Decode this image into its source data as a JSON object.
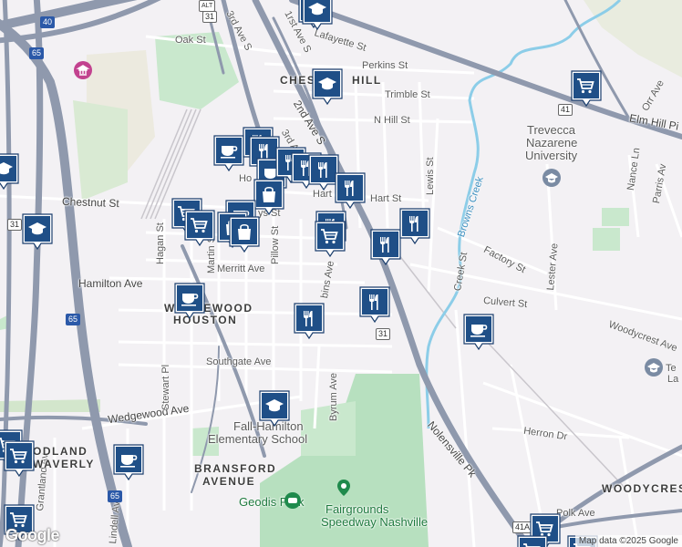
{
  "map": {
    "streets": {
      "oak": "Oak St",
      "lafayette": "Lafayette St",
      "perkins": "Perkins St",
      "trimble": "Trimble St",
      "n_hill": "N Hill St",
      "chestnut": "Chestnut St",
      "hart": "Hart St",
      "hart_short": "Hart",
      "ys": "ys St",
      "merritt": "Merritt Ave",
      "hamilton": "Hamilton Ave",
      "southgate": "Southgate Ave",
      "wedgewood": "Wedgewood Ave",
      "byrum": "Byrum Ave",
      "stewart": "Stewart Pl",
      "pillow": "Pillow St",
      "martin": "Martin St",
      "hagan": "Hagan St",
      "second_ave": "2nd Ave S",
      "third_ave": "3rd Ave",
      "first_ave": "1rst Ave S",
      "third_ave_s": "3rd Ave S",
      "lewis": "Lewis St",
      "factory": "Factory St",
      "culvert": "Culvert St",
      "creek": "Creek St",
      "lester": "Lester Ave",
      "woodycrest_ave": "Woodycrest Ave",
      "herron": "Herron Dr",
      "nolensville": "Nolensville Pk",
      "elm_hill": "Elm Hill Pi",
      "nance": "Nance Ln",
      "parris": "Parris Av",
      "orr": "Orr Ave",
      "browns_creek": "Browns Creek",
      "grantland": "Grantland Av",
      "lindell": "Lindell Av",
      "polk": "Polk Ave",
      "elkins": "bins Ave",
      "ho": "Ho",
      "fragment_br": "Te",
      "fragment_br2": "La"
    },
    "neighborhoods": {
      "chestnut_hill": "CHESTNUT HILL",
      "chestnut_hill_left": "CHES",
      "chestnut_hill_right": "HILL",
      "wedgewood_houston_1": "WEDGEWOOD",
      "wedgewood_houston_2": "HOUSTON",
      "bransford_1": "BRANSFORD",
      "bransford_2": "AVENUE",
      "woodland_1": "ODLAND",
      "woodland_2": "WAVERLY",
      "woodycrest": "WOODYCREST"
    },
    "places": {
      "trevecca_1": "Trevecca",
      "trevecca_2": "Nazarene",
      "trevecca_3": "University",
      "fall_hamilton_1": "Fall-Hamilton",
      "fall_hamilton_2": "Elementary School",
      "geodis": "Geodis Park",
      "fairgrounds_1": "Fairgrounds",
      "fairgrounds_2": "Speedway Nashville"
    },
    "shields": {
      "i40": "40",
      "i65_a": "65",
      "i65_b": "65",
      "i65_c": "65",
      "us31_a": "31",
      "us31_b": "31",
      "us31_c": "31",
      "us41_a": "41",
      "us41_b": "41A",
      "alt": "ALT"
    },
    "copyright": "Map data ©2025 Google",
    "google": "Google"
  }
}
